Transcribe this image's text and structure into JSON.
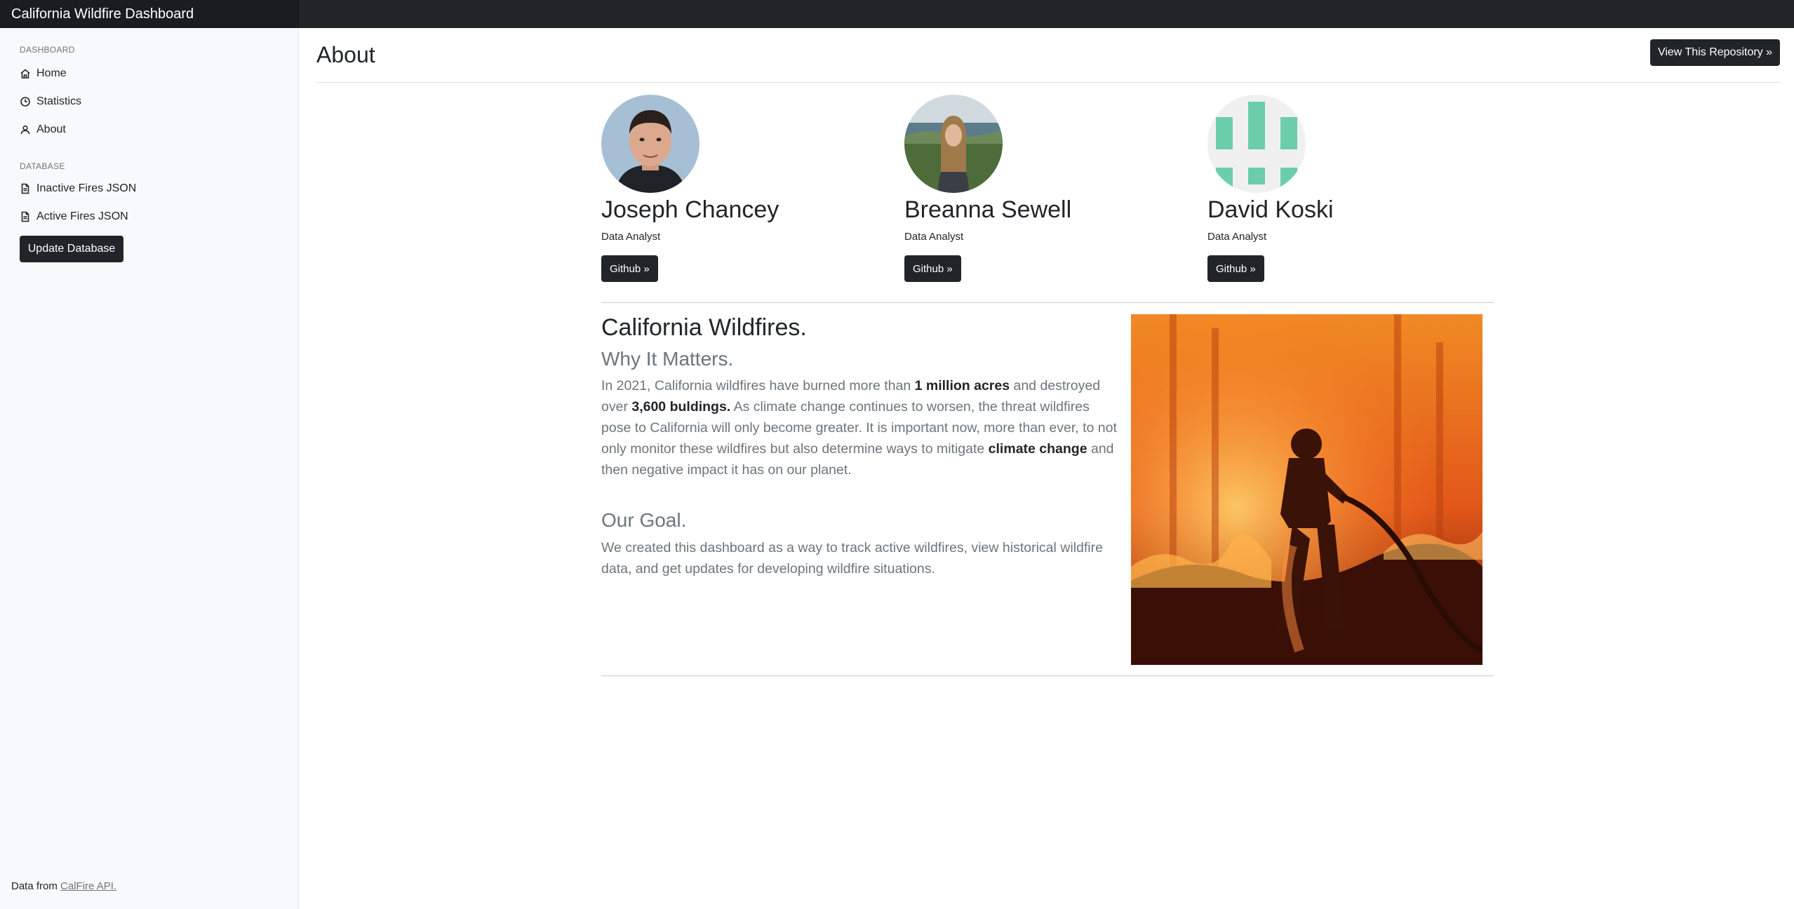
{
  "app": {
    "title": "California Wildfire Dashboard"
  },
  "sidebar": {
    "dashboard_heading": "DASHBOARD",
    "dashboard_items": [
      {
        "label": "Home",
        "icon": "home-icon"
      },
      {
        "label": "Statistics",
        "icon": "clock-icon"
      },
      {
        "label": "About",
        "icon": "user-icon"
      }
    ],
    "database_heading": "DATABASE",
    "database_items": [
      {
        "label": "Inactive Fires JSON",
        "icon": "file-icon"
      },
      {
        "label": "Active Fires JSON",
        "icon": "file-icon"
      }
    ],
    "update_button": "Update Database",
    "footer_prefix": "Data from",
    "footer_link": "CalFire API."
  },
  "header": {
    "title": "About",
    "repo_button": "View This Repository »"
  },
  "team": [
    {
      "name": "Joseph Chancey",
      "role": "Data Analyst",
      "button": "Github »"
    },
    {
      "name": "Breanna Sewell",
      "role": "Data Analyst",
      "button": "Github »"
    },
    {
      "name": "David Koski",
      "role": "Data Analyst",
      "button": "Github »"
    }
  ],
  "content": {
    "title": "California Wildfires.",
    "why_title": "Why It Matters.",
    "why": {
      "p1": "In 2021, California wildfires have burned more than ",
      "b1": "1 million acres",
      "p2": " and destroyed over ",
      "b2": "3,600 buldings.",
      "p3": " As climate change continues to worsen, the threat wildfires pose to California will only become greater. It is important now, more than ever, to not only monitor these wildfires but also determine ways to mitigate ",
      "b3": "climate change",
      "p4": " and then negative impact it has on our planet."
    },
    "goal_title": "Our Goal.",
    "goal_text": "We created this dashboard as a way to track active wildfires, view historical wildfire data, and get updates for developing wildfire situations."
  },
  "colors": {
    "dark": "#212529",
    "muted": "#6c757d",
    "sidebar_bg": "#f8f9fa",
    "identicon": "#6ccdab"
  }
}
